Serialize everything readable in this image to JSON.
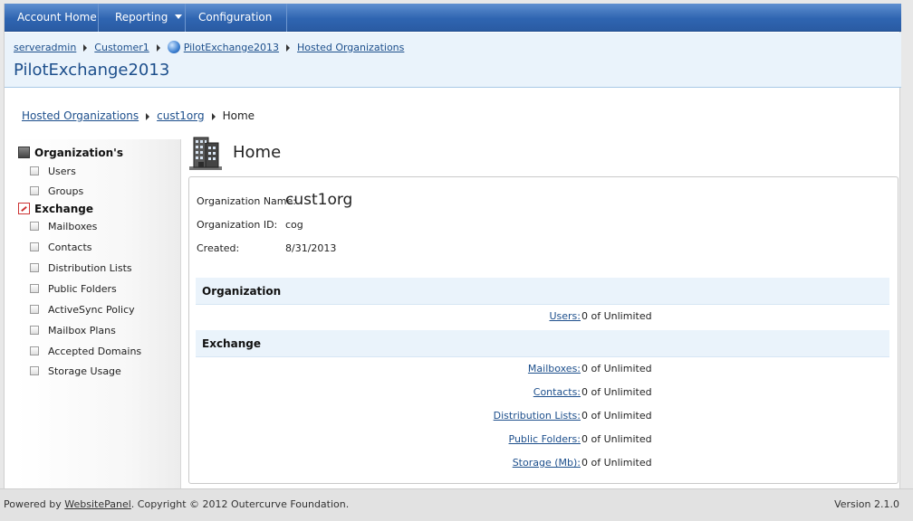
{
  "nav": {
    "items": [
      {
        "label": "Account Home",
        "has_menu": false
      },
      {
        "label": "Reporting",
        "has_menu": true
      },
      {
        "label": "Configuration",
        "has_menu": true
      }
    ]
  },
  "header": {
    "breadcrumbs": [
      "serveradmin",
      "Customer1",
      "PilotExchange2013",
      "Hosted Organizations"
    ],
    "title": "PilotExchange2013"
  },
  "inner_breadcrumbs": {
    "items": [
      "Hosted Organizations",
      "cust1org"
    ],
    "current": "Home"
  },
  "sidebar": {
    "groups": [
      {
        "label": "Organization's",
        "icon": "organization-icon",
        "items": [
          "Users",
          "Groups"
        ]
      },
      {
        "label": "Exchange",
        "icon": "exchange-icon",
        "items": [
          "Mailboxes",
          "Contacts",
          "Distribution Lists",
          "Public Folders",
          "ActiveSync Policy",
          "Mailbox Plans",
          "Accepted Domains",
          "Storage Usage"
        ]
      }
    ]
  },
  "main": {
    "title": "Home",
    "icon": "building-icon",
    "details": {
      "name_label": "Organization Name:",
      "name_value": "cust1org",
      "id_label": "Organization ID:",
      "id_value": "cog",
      "created_label": "Created:",
      "created_value": "8/31/2013"
    },
    "sections": [
      {
        "title": "Organization",
        "rows": [
          {
            "label": "Users:",
            "value": "0 of Unlimited"
          }
        ]
      },
      {
        "title": "Exchange",
        "rows": [
          {
            "label": "Mailboxes:",
            "value": "0 of Unlimited"
          },
          {
            "label": "Contacts:",
            "value": "0 of Unlimited"
          },
          {
            "label": "Distribution Lists:",
            "value": "0 of Unlimited"
          },
          {
            "label": "Public Folders:",
            "value": "0 of Unlimited"
          },
          {
            "label": "Storage (Mb):",
            "value": "0 of Unlimited"
          }
        ]
      }
    ]
  },
  "footer": {
    "powered_prefix": "Powered by ",
    "powered_link": "WebsitePanel",
    "copyright": ". Copyright © 2012 Outercurve Foundation.",
    "version": "Version 2.1.0"
  },
  "colors": {
    "nav_blue": "#2f65b1",
    "header_bg": "#eaf3fb",
    "link": "#1d4f8c"
  }
}
